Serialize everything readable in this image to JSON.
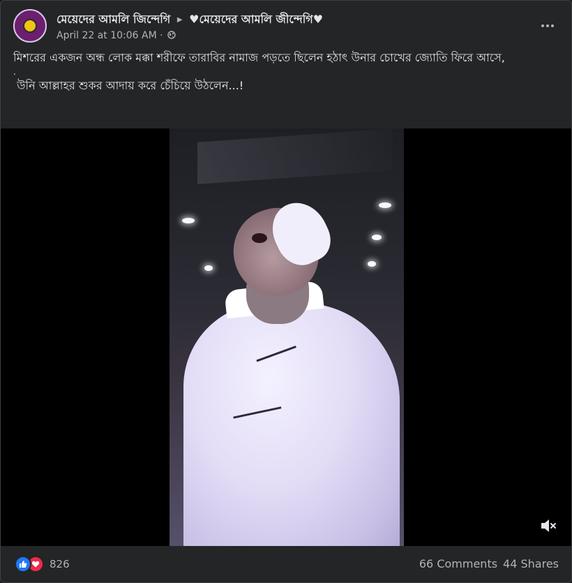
{
  "post": {
    "page_name": "মেয়েদের আমলি জিন্দেগি",
    "group_name": "♥মেয়েদের আমলি জীন্দেগি♥",
    "timestamp": "April 22 at 10:06 AM",
    "separator": "·",
    "text_lines": [
      "মিশরের একজন অন্ধ লোক মক্কা শরীফে তারাবির নামাজ পড়তে ছিলেন হঠাৎ উনার চোখের জ্যোতি ফিরে আসে,",
      ".",
      " উনি আল্লাহর শুকর আদায় করে চেঁচিয়ে উঠলেন...!"
    ]
  },
  "icons": {
    "more": "more-horizontal-icon",
    "audience": "globe-icon",
    "mute": "speaker-muted-icon",
    "like": "like-reaction-icon",
    "love": "love-reaction-icon"
  },
  "footer": {
    "reaction_count": "826",
    "comments": "66 Comments",
    "shares": "44 Shares"
  },
  "colors": {
    "card_bg": "#242526",
    "page_bg": "#18191a",
    "text_primary": "#e4e6eb",
    "text_secondary": "#b0b3b8",
    "like_blue": "#2078f4",
    "love_red": "#f0284a"
  }
}
